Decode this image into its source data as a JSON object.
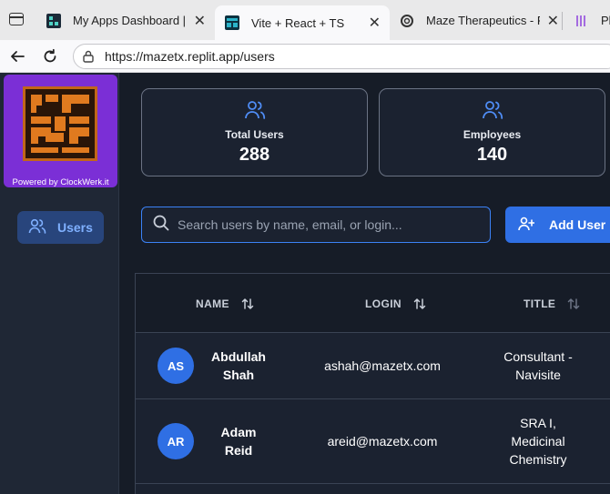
{
  "browser": {
    "tabs": [
      {
        "title": "My Apps Dashboard | ma",
        "favicon": "replit-icon"
      },
      {
        "title": "Vite + React + TS",
        "favicon": "maze-icon"
      },
      {
        "title": "Maze Therapeutics - Rep",
        "favicon": "openai-icon"
      },
      {
        "title": "Plia",
        "favicon": "plia-icon"
      }
    ],
    "url": "https://mazetx.replit.app/users"
  },
  "sidebar": {
    "powered_by": "Powered by ClockWerk.it",
    "items": [
      {
        "label": "Users",
        "icon": "users-icon"
      }
    ]
  },
  "stats": [
    {
      "label": "Total Users",
      "value": "288",
      "icon": "users-icon"
    },
    {
      "label": "Employees",
      "value": "140",
      "icon": "users-icon"
    }
  ],
  "search": {
    "placeholder": "Search users by name, email, or login...",
    "value": ""
  },
  "add_user_label": "Add User",
  "table": {
    "columns": [
      "NAME",
      "LOGIN",
      "TITLE"
    ],
    "rows": [
      {
        "initials": "AS",
        "first": "Abdullah",
        "last": "Shah",
        "login": "ashah@mazetx.com",
        "title_lines": [
          "Consultant -",
          "Navisite"
        ]
      },
      {
        "initials": "AR",
        "first": "Adam",
        "last": "Reid",
        "login": "areid@mazetx.com",
        "title_lines": [
          "SRA I,",
          "Medicinal",
          "Chemistry"
        ]
      }
    ]
  },
  "colors": {
    "accent": "#2f6fe4",
    "logo_purple": "#7b2fd6",
    "logo_orange": "#e07a1f"
  }
}
